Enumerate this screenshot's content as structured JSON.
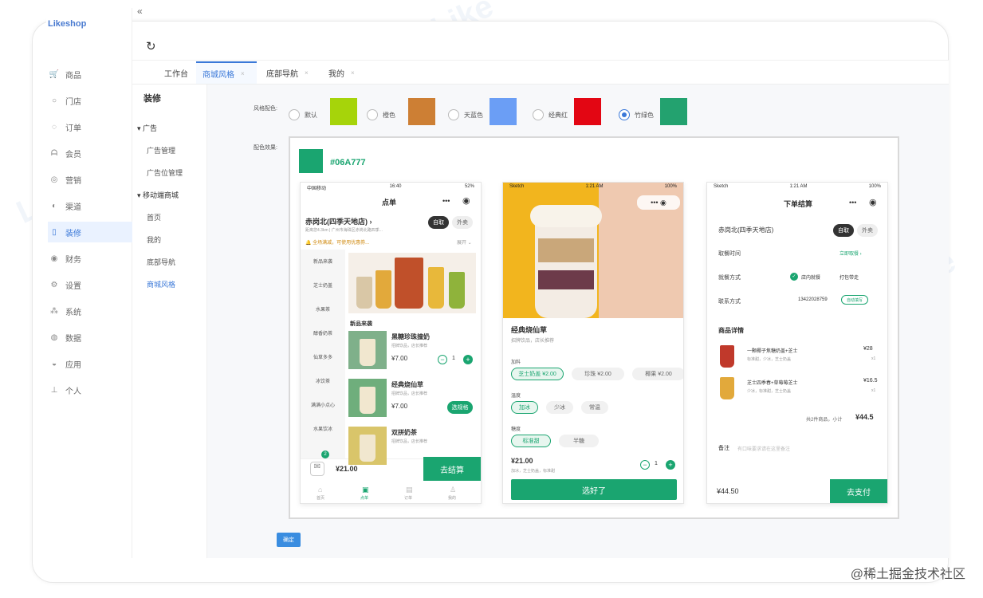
{
  "app": {
    "logo": "Likeshop",
    "refresh_icon": "refresh-icon"
  },
  "sidebar": {
    "items": [
      {
        "icon": "cart-icon",
        "glyph": "🛒",
        "label": "商品"
      },
      {
        "icon": "store-icon",
        "glyph": "○",
        "label": "门店"
      },
      {
        "icon": "order-icon",
        "glyph": "◌",
        "label": "订单"
      },
      {
        "icon": "user-icon",
        "glyph": "ᗩ",
        "label": "会员"
      },
      {
        "icon": "marketing-icon",
        "glyph": "◎",
        "label": "营销"
      },
      {
        "icon": "channel-icon",
        "glyph": "◐",
        "label": "渠道"
      },
      {
        "icon": "decorate-icon",
        "glyph": "▯",
        "label": "装修"
      },
      {
        "icon": "finance-icon",
        "glyph": "◉",
        "label": "财务"
      },
      {
        "icon": "settings-icon",
        "glyph": "⚙",
        "label": "设置"
      },
      {
        "icon": "system-icon",
        "glyph": "⁂",
        "label": "系统"
      },
      {
        "icon": "data-icon",
        "glyph": "◍",
        "label": "数据"
      },
      {
        "icon": "apps-icon",
        "glyph": "◒",
        "label": "应用"
      },
      {
        "icon": "person-icon",
        "glyph": "⊥",
        "label": "个人"
      }
    ]
  },
  "tabs": {
    "collapse": "«",
    "items": [
      "工作台",
      "商城风格",
      "底部导航",
      "我的"
    ],
    "close": "×"
  },
  "submenu": {
    "title": "装修",
    "groups": [
      {
        "label": "广告",
        "items": [
          "广告管理",
          "广告位管理"
        ]
      },
      {
        "label": "移动端商城",
        "items": [
          "首页",
          "我的",
          "底部导航",
          "商城风格"
        ]
      }
    ]
  },
  "style_page": {
    "color_label": "风格配色:",
    "preview_label": "配色效果:",
    "options": [
      {
        "label": "默认",
        "color": "#a6d40a"
      },
      {
        "label": "橙色",
        "color": "#cd7f34"
      },
      {
        "label": "天蓝色",
        "color": "#6b9ef5"
      },
      {
        "label": "经典红",
        "color": "#e30613"
      },
      {
        "label": "竹绿色",
        "color": "#23a26f"
      }
    ],
    "selected_hex": "#06A777",
    "selected_color": "#1aa570",
    "confirm": "确定"
  },
  "phone1": {
    "status": {
      "left": "中国移动",
      "time": "16:40",
      "right": "52%"
    },
    "title": "点单",
    "store": "赤岗北(四季天地店) ›",
    "store_sub": "距离您4.3km | 广州市海珠区赤岗北路四季...",
    "notice": "🔔 全场满减，可使用优惠券...",
    "notice_more": "展开 ⌄",
    "mode_a": "自取",
    "mode_b": "外卖",
    "categories": [
      "新品来袭",
      "芝士奶盖",
      "水果茶",
      "醇香奶茶",
      "仙草多多",
      "冰饮茶",
      "满满小点心",
      "水果饮冰"
    ],
    "section": "新品来袭",
    "products": [
      {
        "name": "黑糖珍珠撞奶",
        "desc": "招牌饮品，店长推荐",
        "price": "¥7.00",
        "qty": "1"
      },
      {
        "name": "经典烧仙草",
        "desc": "招牌饮品，店长推荐",
        "price": "¥7.00",
        "action": "选规格"
      },
      {
        "name": "双拼奶茶",
        "desc": "招牌饮品，店长推荐"
      }
    ],
    "cart_badge": "2",
    "total": "¥21.00",
    "checkout": "去结算",
    "nav": [
      "首页",
      "点单",
      "订单",
      "我的"
    ]
  },
  "phone2": {
    "status": {
      "left": "Sketch",
      "time": "1:21 AM",
      "right": "100%"
    },
    "name": "经典烧仙草",
    "desc": "招牌饮品，店长推荐",
    "groups": [
      {
        "label": "加料",
        "options": [
          "芝士奶盖 ¥2.00",
          "珍珠 ¥2.00",
          "椰果 ¥2.00"
        ]
      },
      {
        "label": "温度",
        "options": [
          "加冰",
          "少冰",
          "常温"
        ]
      },
      {
        "label": "糖度",
        "options": [
          "标准甜",
          "半糖"
        ]
      }
    ],
    "price": "¥21.00",
    "selected": "加冰，芝士奶盖，标准甜",
    "qty": "1",
    "button": "选好了"
  },
  "phone3": {
    "status": {
      "left": "Sketch",
      "time": "1:21 AM",
      "right": "100%"
    },
    "title": "下单结算",
    "store": "赤岗北(四季天地店)",
    "mode_a": "自取",
    "mode_b": "外卖",
    "rows": [
      {
        "label": "取餐时间",
        "value": "立即取餐 ›"
      },
      {
        "label": "就餐方式",
        "value": "店内就餐",
        "value2": "打包带走"
      },
      {
        "label": "联系方式",
        "value": "13422028759",
        "tag": "自动填写"
      }
    ],
    "detail_title": "商品详情",
    "items": [
      {
        "name": "一颗椰子焦糖奶盖+芝士",
        "spec": "标准甜，少冰，芝士奶盖",
        "price": "¥28",
        "qty": "x1"
      },
      {
        "name": "芝士四季春+草莓莓芝士",
        "spec": "少冰，标准甜，芝士奶盖",
        "price": "¥16.5",
        "qty": "x1"
      }
    ],
    "summary": "共2件商品，小计",
    "subtotal": "¥44.5",
    "remark_label": "备注",
    "remark_ph": "有口味要求请在这里备注",
    "total": "¥44.50",
    "pay": "去支付"
  },
  "footer_watermark": "@稀土掘金技术社区"
}
